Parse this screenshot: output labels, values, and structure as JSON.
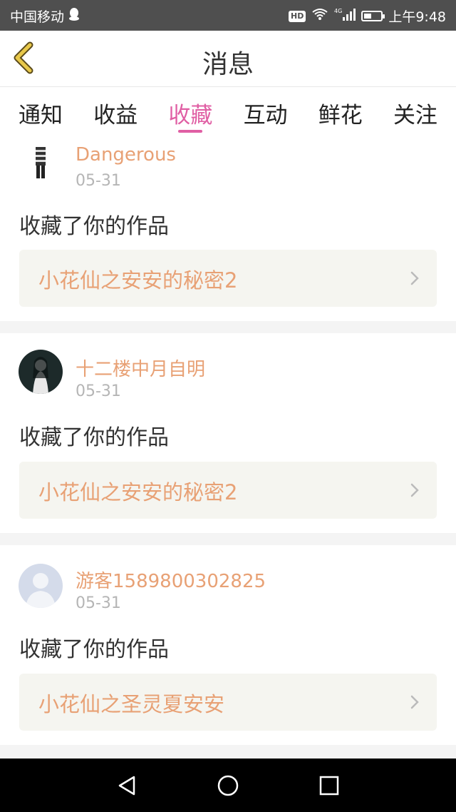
{
  "status_bar": {
    "carrier": "中国移动",
    "hd_badge": "HD",
    "signal_label": "4G",
    "time": "上午9:48"
  },
  "header": {
    "title": "消息",
    "back_icon": "chevron-left-icon"
  },
  "tabs": [
    {
      "label": "通知",
      "active": false
    },
    {
      "label": "收益",
      "active": false
    },
    {
      "label": "收藏",
      "active": true
    },
    {
      "label": "互动",
      "active": false
    },
    {
      "label": "鲜花",
      "active": false
    },
    {
      "label": "关注",
      "active": false
    }
  ],
  "messages": [
    {
      "username": "Dangerous",
      "date": "05-31",
      "action": "收藏了你的作品",
      "work_title": "小花仙之安安的秘密2"
    },
    {
      "username": "十二楼中月自明",
      "date": "05-31",
      "action": "收藏了你的作品",
      "work_title": "小花仙之安安的秘密2"
    },
    {
      "username": "游客1589800302825",
      "date": "05-31",
      "action": "收藏了你的作品",
      "work_title": "小花仙之圣灵夏安安"
    }
  ],
  "colors": {
    "accent_pink": "#e05fa4",
    "name_orange": "#e8a175",
    "back_yellow": "#e8c84a"
  },
  "nav": [
    "back-triangle-icon",
    "home-circle-icon",
    "recents-square-icon"
  ]
}
